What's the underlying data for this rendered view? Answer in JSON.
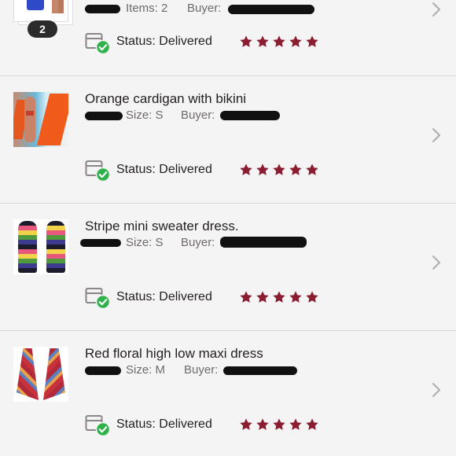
{
  "colors": {
    "star": "#8b1d31",
    "check": "#2fb24a",
    "text": "#231f20",
    "meta": "#6f6a6d"
  },
  "orders": [
    {
      "title": "",
      "meta1_label": "Items: 2",
      "meta2_label": "Buyer:",
      "badge": "2",
      "status_label": "Status:",
      "status_value": "Delivered",
      "rating": 5
    },
    {
      "title": "Orange cardigan with bikini",
      "meta1_label": "Size: S",
      "meta2_label": "Buyer:",
      "status_label": "Status:",
      "status_value": "Delivered",
      "rating": 5
    },
    {
      "title": "Stripe mini sweater dress.",
      "meta1_label": "Size: S",
      "meta2_label": "Buyer:",
      "status_label": "Status:",
      "status_value": "Delivered",
      "rating": 5
    },
    {
      "title": "Red floral high low maxi dress",
      "meta1_label": "Size: M",
      "meta2_label": "Buyer:",
      "status_label": "Status:",
      "status_value": "Delivered",
      "rating": 5
    }
  ]
}
